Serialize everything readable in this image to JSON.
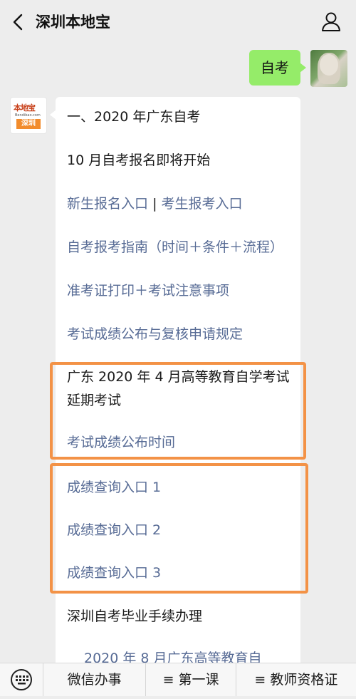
{
  "header": {
    "title": "深圳本地宝",
    "back_icon": "chevron-left-icon",
    "profile_icon": "person-icon"
  },
  "chat": {
    "user_message": "自考",
    "bot_avatar": {
      "logo_text": "本地宝",
      "domain": "Bendibao.com",
      "city": "深圳"
    },
    "bot_message": {
      "heading": "一、2020 年广东自考",
      "sub_heading": "10 月自考报名即将开始",
      "links": {
        "new_signup": "新生报名入口",
        "separator": "|",
        "exam_signup": "考生报考入口",
        "guide": "自考报考指南（时间＋条件＋流程）",
        "admission_print": "准考证打印＋考试注意事项",
        "score_rules": "考试成绩公布与复核申请规定",
        "score_time": "考试成绩公布时间",
        "score_query_1": "成绩查询入口 1",
        "score_query_2": "成绩查询入口 2",
        "score_query_3": "成绩查询入口 3",
        "cut_off": "2020 年 8 月广东高等教育自"
      },
      "postpone_notice": "广东 2020 年 4 月高等教育自学考试延期考试",
      "graduation": "深圳自考毕业手续办理"
    }
  },
  "bottom_menu": {
    "keyboard_icon": "keyboard-icon",
    "items": [
      {
        "label": "微信办事"
      },
      {
        "icon": "≡",
        "label": "第一课"
      },
      {
        "icon": "≡",
        "label": "教师资格证"
      }
    ]
  },
  "colors": {
    "link": "#576b95",
    "user_bubble": "#95ec69",
    "highlight": "#f39246",
    "background": "#ededed"
  }
}
